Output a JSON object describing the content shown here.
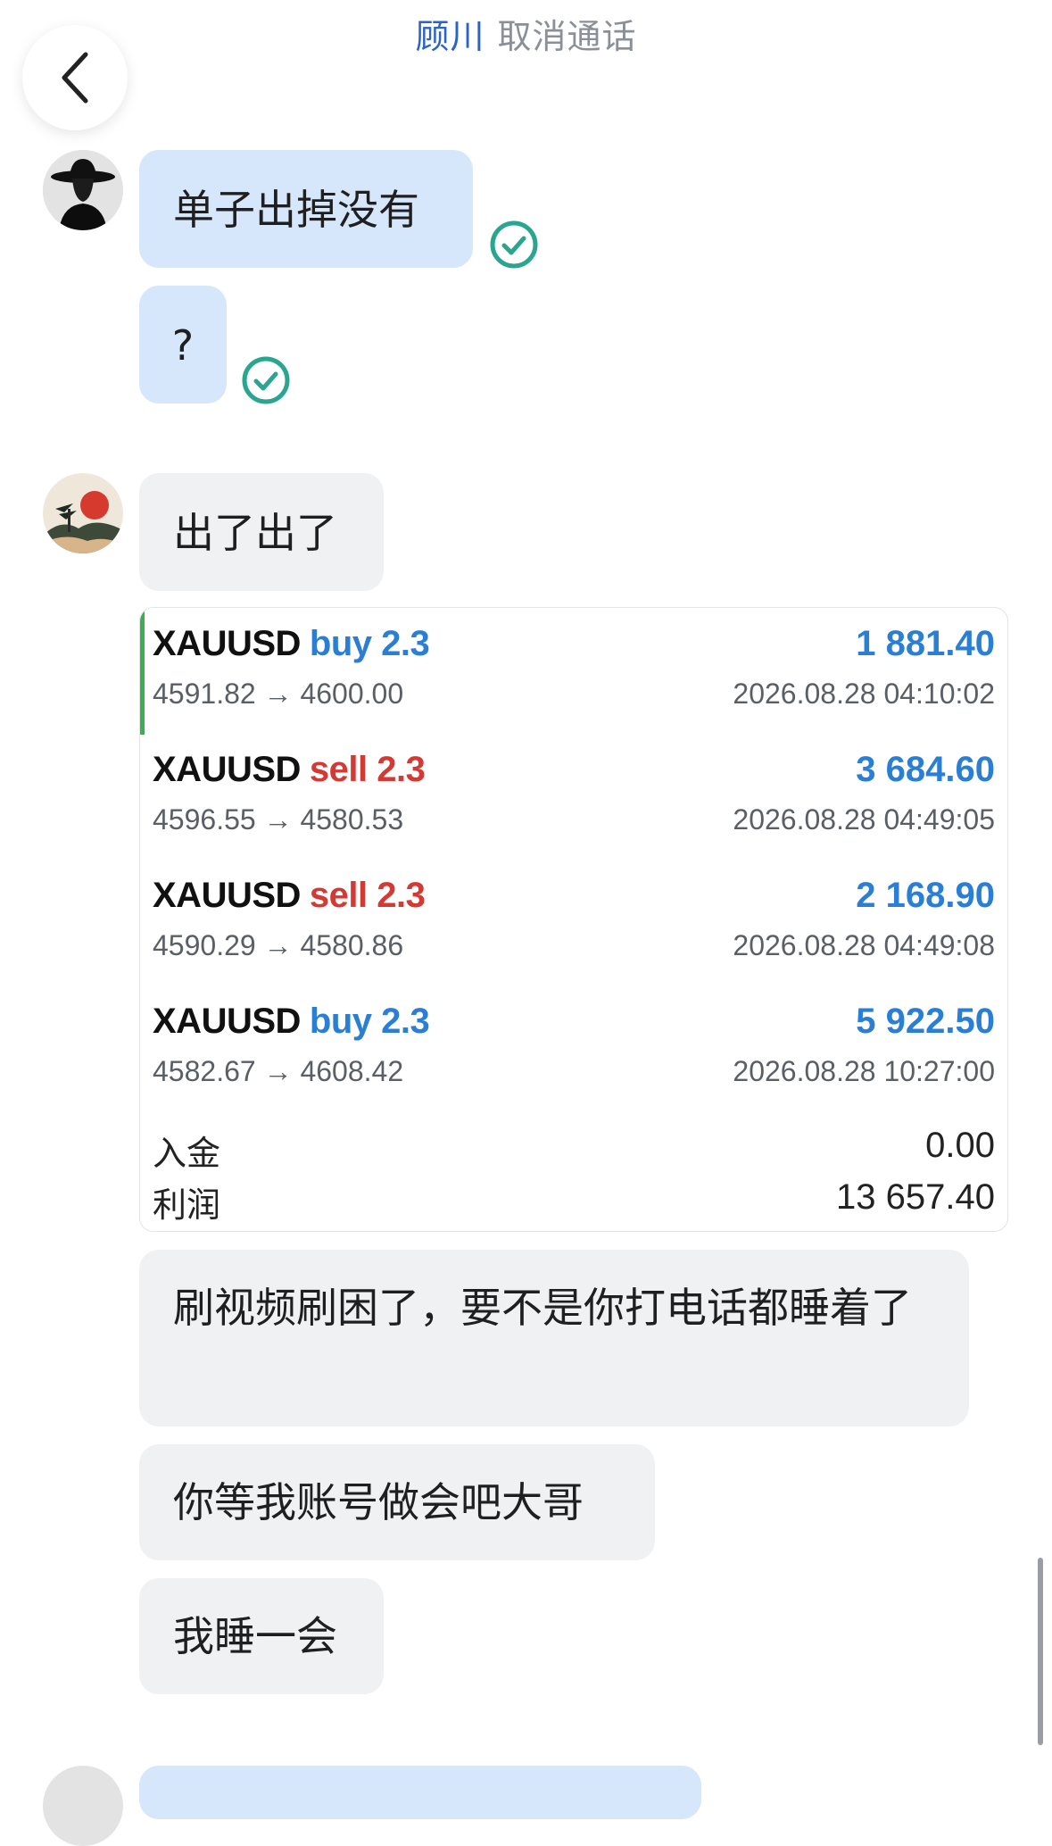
{
  "call_banner": {
    "name": "顾川",
    "action": "取消通话"
  },
  "icons": {
    "back": "chevron-left-icon",
    "read_receipt": "check-circle-icon"
  },
  "colors": {
    "accent": "#2b63c6",
    "buy": "#2a7fd4",
    "sell": "#d33a34",
    "check": "#2aa58f"
  },
  "messages": [
    {
      "text": "单子出掉没有"
    },
    {
      "text": "?"
    },
    {
      "text": "出了出了"
    },
    {
      "text": "刷视频刷困了，要不是你打电话都睡着了"
    },
    {
      "text": "你等我账号做会吧大哥"
    },
    {
      "text": "我睡一会"
    }
  ],
  "trade_card": {
    "trades": [
      {
        "symbol": "XAUUSD",
        "side": "buy",
        "volume": "2.3",
        "prices": "4591.82 → 4600.00",
        "profit": "1 881.40",
        "time": "2026.08.28 04:10:02"
      },
      {
        "symbol": "XAUUSD",
        "side": "sell",
        "volume": "2.3",
        "prices": "4596.55 → 4580.53",
        "profit": "3 684.60",
        "time": "2026.08.28 04:49:05"
      },
      {
        "symbol": "XAUUSD",
        "side": "sell",
        "volume": "2.3",
        "prices": "4590.29 → 4580.86",
        "profit": "2 168.90",
        "time": "2026.08.28 04:49:08"
      },
      {
        "symbol": "XAUUSD",
        "side": "buy",
        "volume": "2.3",
        "prices": "4582.67 → 4608.42",
        "profit": "5 922.50",
        "time": "2026.08.28 10:27:00"
      }
    ],
    "deposit_label": "入金",
    "deposit_value": "0.00",
    "profit_label": "利润",
    "profit_value": "13 657.40"
  }
}
